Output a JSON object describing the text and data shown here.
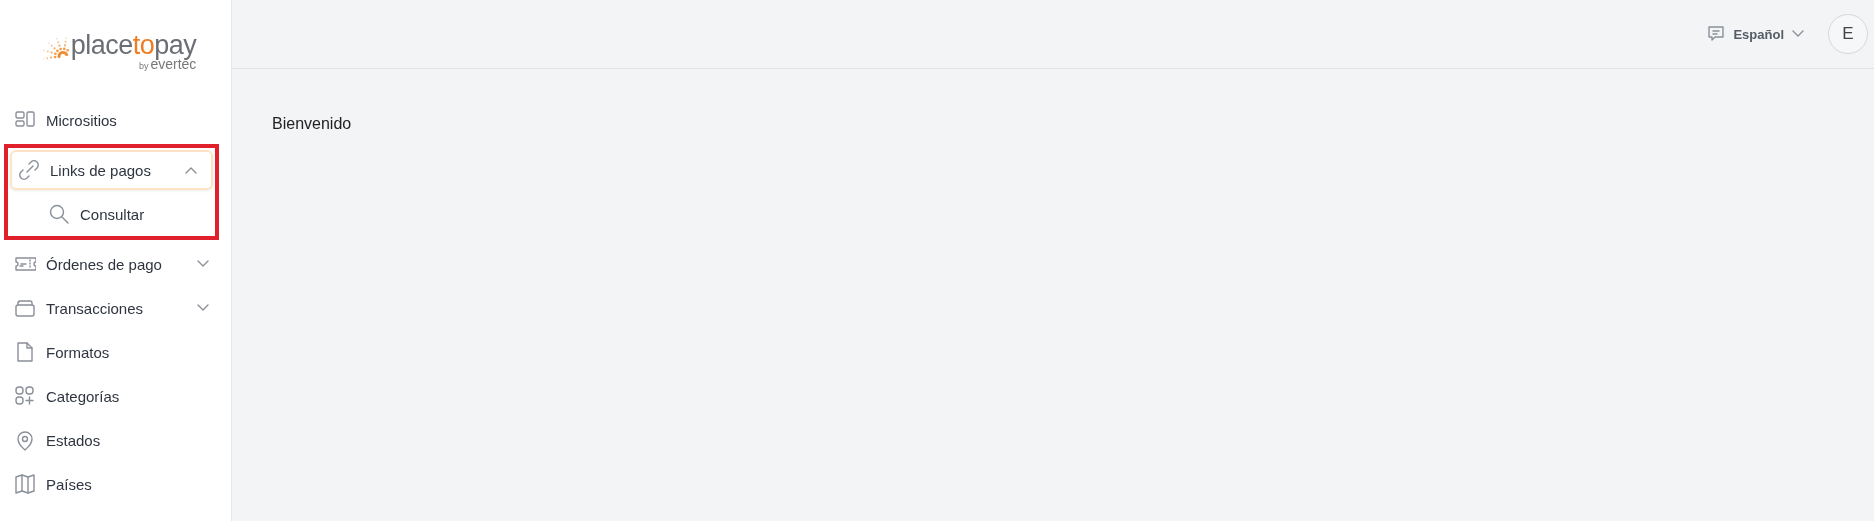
{
  "logo": {
    "parts": [
      {
        "text": "place",
        "accent": false
      },
      {
        "text": "to",
        "accent": true
      },
      {
        "text": "pay",
        "accent": false
      }
    ],
    "by": "by",
    "brand": "evertec"
  },
  "sidebar": {
    "items": [
      {
        "kind": "microsites",
        "label": "Micrositios",
        "expanded": false,
        "expandable": false,
        "highlighted": false
      },
      {
        "kind": "link",
        "label": "Links de pagos",
        "expanded": true,
        "expandable": true,
        "highlighted": true,
        "children": [
          {
            "kind": "search",
            "label": "Consultar"
          }
        ]
      },
      {
        "kind": "ticket",
        "label": "Órdenes de pago",
        "expanded": false,
        "expandable": true,
        "highlighted": false
      },
      {
        "kind": "stack",
        "label": "Transacciones",
        "expanded": false,
        "expandable": true,
        "highlighted": false
      },
      {
        "kind": "file",
        "label": "Formatos",
        "expanded": false,
        "expandable": false,
        "highlighted": false
      },
      {
        "kind": "grid",
        "label": "Categorías",
        "expanded": false,
        "expandable": false,
        "highlighted": false
      },
      {
        "kind": "pin",
        "label": "Estados",
        "expanded": false,
        "expandable": false,
        "highlighted": false
      },
      {
        "kind": "map",
        "label": "Países",
        "expanded": false,
        "expandable": false,
        "highlighted": false
      }
    ]
  },
  "header": {
    "language": "Español",
    "avatar": "E"
  },
  "main": {
    "title": "Bienvenido"
  }
}
